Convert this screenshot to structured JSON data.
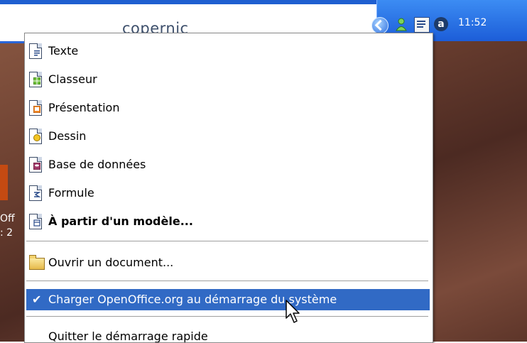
{
  "topbar": {
    "logo_text": "copernic"
  },
  "tray": {
    "clock": "11:52",
    "icons": [
      "back-arrow-icon",
      "user-icon",
      "openoffice-icon",
      "antivirus-icon"
    ]
  },
  "desktop": {
    "fragment_1": "Off",
    "fragment_2": ": 2"
  },
  "context_menu": {
    "items": [
      {
        "label": "Texte",
        "icon": "writer-doc-icon"
      },
      {
        "label": "Classeur",
        "icon": "calc-doc-icon"
      },
      {
        "label": "Présentation",
        "icon": "impress-doc-icon"
      },
      {
        "label": "Dessin",
        "icon": "draw-doc-icon"
      },
      {
        "label": "Base de données",
        "icon": "base-doc-icon"
      },
      {
        "label": "Formule",
        "icon": "math-doc-icon"
      },
      {
        "label": "À partir d'un modèle...",
        "icon": "template-doc-icon",
        "bold": true
      }
    ],
    "open_document": {
      "label": "Ouvrir un document...",
      "icon": "folder-icon"
    },
    "load_at_startup": {
      "label": "Charger OpenOffice.org au démarrage du système",
      "checked": true,
      "check_glyph": "✔"
    },
    "quit": {
      "label": "Quitter le démarrage rapide"
    }
  },
  "colors": {
    "selection": "#316ac5",
    "taskbar": "#1f5fd0",
    "tray": "#2a6fe3"
  }
}
